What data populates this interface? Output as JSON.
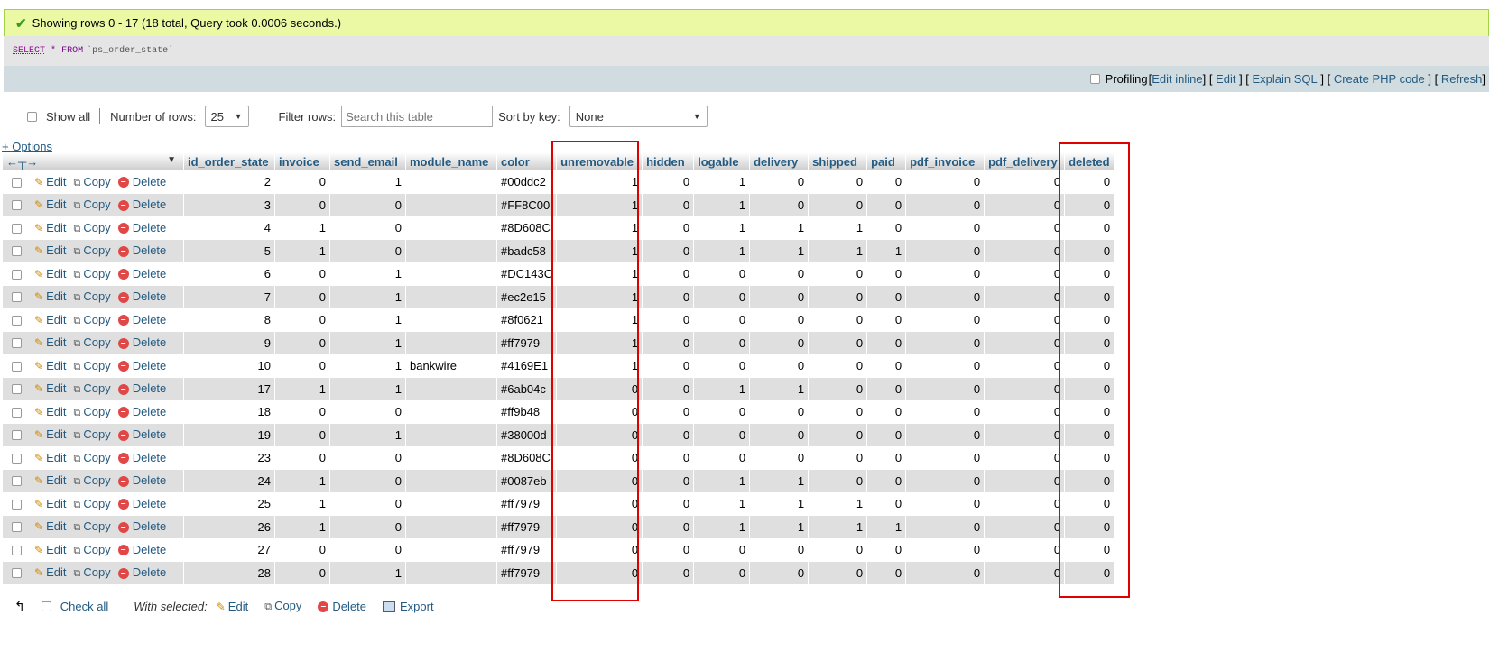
{
  "message": "Showing rows 0 - 17 (18 total, Query took 0.0006 seconds.)",
  "sql": {
    "select": "SELECT",
    "star": "*",
    "from": "FROM",
    "table": "`ps_order_state`"
  },
  "toolbar": {
    "profiling": "Profiling",
    "links": [
      {
        "label": "Edit inline"
      },
      {
        "label": "Edit"
      },
      {
        "label": "Explain SQL"
      },
      {
        "label": "Create PHP code"
      },
      {
        "label": "Refresh"
      }
    ]
  },
  "controls": {
    "show_all": "Show all",
    "num_rows_label": "Number of rows:",
    "num_rows_value": "25",
    "filter_label": "Filter rows:",
    "filter_placeholder": "Search this table",
    "sort_label": "Sort by key:",
    "sort_value": "None"
  },
  "options_label": "+ Options",
  "columns": [
    "id_order_state",
    "invoice",
    "send_email",
    "module_name",
    "color",
    "unremovable",
    "hidden",
    "logable",
    "delivery",
    "shipped",
    "paid",
    "pdf_invoice",
    "pdf_delivery",
    "deleted"
  ],
  "actions": {
    "edit": "Edit",
    "copy": "Copy",
    "delete": "Delete"
  },
  "rows": [
    [
      "2",
      "0",
      "1",
      "",
      "#00ddc2",
      "1",
      "0",
      "1",
      "0",
      "0",
      "0",
      "0",
      "0",
      "0"
    ],
    [
      "3",
      "0",
      "0",
      "",
      "#FF8C00",
      "1",
      "0",
      "1",
      "0",
      "0",
      "0",
      "0",
      "0",
      "0"
    ],
    [
      "4",
      "1",
      "0",
      "",
      "#8D608C",
      "1",
      "0",
      "1",
      "1",
      "1",
      "0",
      "0",
      "0",
      "0"
    ],
    [
      "5",
      "1",
      "0",
      "",
      "#badc58",
      "1",
      "0",
      "1",
      "1",
      "1",
      "1",
      "0",
      "0",
      "0"
    ],
    [
      "6",
      "0",
      "1",
      "",
      "#DC143C",
      "1",
      "0",
      "0",
      "0",
      "0",
      "0",
      "0",
      "0",
      "0"
    ],
    [
      "7",
      "0",
      "1",
      "",
      "#ec2e15",
      "1",
      "0",
      "0",
      "0",
      "0",
      "0",
      "0",
      "0",
      "0"
    ],
    [
      "8",
      "0",
      "1",
      "",
      "#8f0621",
      "1",
      "0",
      "0",
      "0",
      "0",
      "0",
      "0",
      "0",
      "0"
    ],
    [
      "9",
      "0",
      "1",
      "",
      "#ff7979",
      "1",
      "0",
      "0",
      "0",
      "0",
      "0",
      "0",
      "0",
      "0"
    ],
    [
      "10",
      "0",
      "1",
      "bankwire",
      "#4169E1",
      "1",
      "0",
      "0",
      "0",
      "0",
      "0",
      "0",
      "0",
      "0"
    ],
    [
      "17",
      "1",
      "1",
      "",
      "#6ab04c",
      "0",
      "0",
      "1",
      "1",
      "0",
      "0",
      "0",
      "0",
      "0"
    ],
    [
      "18",
      "0",
      "0",
      "",
      "#ff9b48",
      "0",
      "0",
      "0",
      "0",
      "0",
      "0",
      "0",
      "0",
      "0"
    ],
    [
      "19",
      "0",
      "1",
      "",
      "#38000d",
      "0",
      "0",
      "0",
      "0",
      "0",
      "0",
      "0",
      "0",
      "0"
    ],
    [
      "23",
      "0",
      "0",
      "",
      "#8D608C",
      "0",
      "0",
      "0",
      "0",
      "0",
      "0",
      "0",
      "0",
      "0"
    ],
    [
      "24",
      "1",
      "0",
      "",
      "#0087eb",
      "0",
      "0",
      "1",
      "1",
      "0",
      "0",
      "0",
      "0",
      "0"
    ],
    [
      "25",
      "1",
      "0",
      "",
      "#ff7979",
      "0",
      "0",
      "1",
      "1",
      "1",
      "0",
      "0",
      "0",
      "0"
    ],
    [
      "26",
      "1",
      "0",
      "",
      "#ff7979",
      "0",
      "0",
      "1",
      "1",
      "1",
      "1",
      "0",
      "0",
      "0"
    ],
    [
      "27",
      "0",
      "0",
      "",
      "#ff7979",
      "0",
      "0",
      "0",
      "0",
      "0",
      "0",
      "0",
      "0",
      "0"
    ],
    [
      "28",
      "0",
      "1",
      "",
      "#ff7979",
      "0",
      "0",
      "0",
      "0",
      "0",
      "0",
      "0",
      "0",
      "0"
    ]
  ],
  "bottom": {
    "check_all": "Check all",
    "with_selected": "With selected:",
    "edit": "Edit",
    "copy": "Copy",
    "delete": "Delete",
    "export": "Export"
  }
}
